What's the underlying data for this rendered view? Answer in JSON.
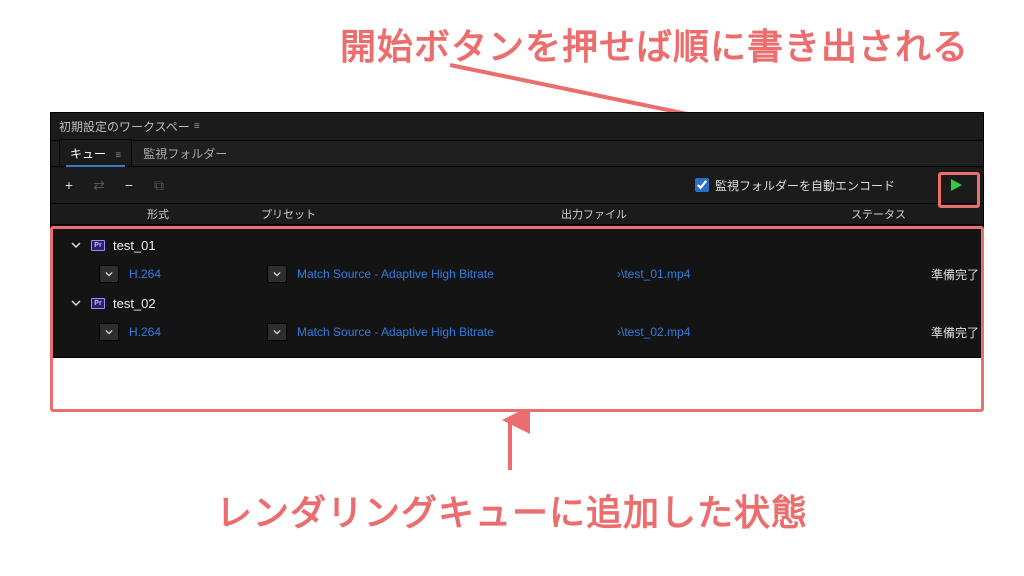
{
  "annotations": {
    "top": "開始ボタンを押せば順に書き出される",
    "bottom": "レンダリングキューに追加した状態"
  },
  "workspace": {
    "label": "初期設定のワークスペー"
  },
  "tabs": {
    "queue": "キュー",
    "watch": "監視フォルダー"
  },
  "toolbar": {
    "add": "+",
    "remove": "−",
    "autoEncodeLabel": "監視フォルダーを自動エンコード",
    "autoEncodeChecked": true
  },
  "columns": {
    "format": "形式",
    "preset": "プリセット",
    "output": "出力ファイル",
    "status": "ステータス"
  },
  "items": [
    {
      "name": "test_01",
      "format": "H.264",
      "preset": "Match Source - Adaptive High Bitrate",
      "output": "›\\test_01.mp4",
      "status": "準備完了"
    },
    {
      "name": "test_02",
      "format": "H.264",
      "preset": "Match Source - Adaptive High Bitrate",
      "output": "›\\test_02.mp4",
      "status": "準備完了"
    }
  ],
  "icons": {
    "prBadge": "Pr"
  }
}
